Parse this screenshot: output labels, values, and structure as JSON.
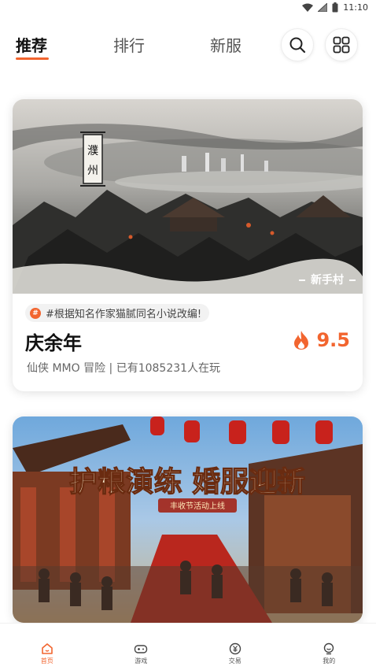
{
  "status_bar": {
    "time": "11:10"
  },
  "tabs": [
    {
      "label": "推荐",
      "active": true
    },
    {
      "label": "排行",
      "active": false
    },
    {
      "label": "新服",
      "active": false
    }
  ],
  "header_icons": {
    "search": "search-icon",
    "grid": "grid-icon"
  },
  "cards": [
    {
      "image_caption": "新手村",
      "image_seal": "濮州",
      "tag": "#根据知名作家猫腻同名小说改编!",
      "title": "庆余年",
      "rating": "9.5",
      "meta": "仙侠  MMO  冒险 | 已有1085231人在玩"
    },
    {
      "banner_text": "护粮演练 婚服迎新",
      "banner_subtitle": "丰收节活动上线"
    }
  ],
  "bottom_nav": [
    {
      "label": "首页",
      "icon": "home-icon",
      "active": true
    },
    {
      "label": "游戏",
      "icon": "gamepad-icon",
      "active": false
    },
    {
      "label": "交易",
      "icon": "trade-icon",
      "active": false
    },
    {
      "label": "我的",
      "icon": "profile-icon",
      "active": false
    }
  ],
  "colors": {
    "accent": "#f2652f",
    "text": "#111111",
    "muted": "#666666"
  }
}
